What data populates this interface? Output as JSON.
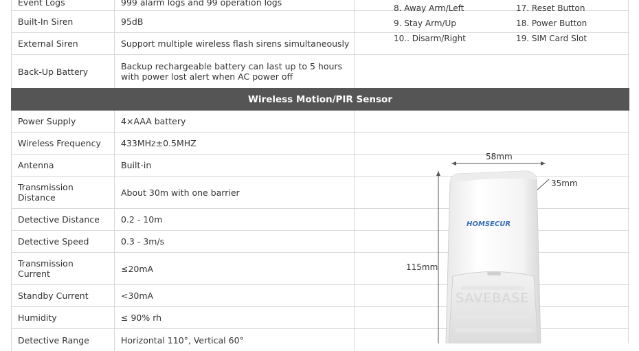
{
  "top_rows": [
    {
      "label": "Event Logs",
      "value": "999 alarm logs and 99 operation logs"
    },
    {
      "label": "Built-In Siren",
      "value": "95dB"
    },
    {
      "label": "External Siren",
      "value": "Support multiple wireless flash sirens simultaneously"
    },
    {
      "label": "Back-Up Battery",
      "value": "Backup rechargeable battery can last up to 5 hours with power lost alert when AC power off"
    }
  ],
  "button_list": {
    "left": [
      "8. Away Arm/Left",
      "9. Stay Arm/Up",
      "10.. Disarm/Right"
    ],
    "right": [
      "17. Reset Button",
      "18. Power Button",
      "19. SIM Card Slot"
    ]
  },
  "section_title": "Wireless Motion/PIR Sensor",
  "sensor_rows": [
    {
      "label": "Power Supply",
      "value": "4×AAA battery"
    },
    {
      "label": "Wireless Frequency",
      "value": "433MHz±0.5MHZ"
    },
    {
      "label": "Antenna",
      "value": "Built-in"
    },
    {
      "label": "Transmission Distance",
      "value": "About 30m with one barrier"
    },
    {
      "label": "Detective Distance",
      "value": "0.2 - 10m"
    },
    {
      "label": "Detective Speed",
      "value": "0.3 - 3m/s"
    },
    {
      "label": "Transmission Current",
      "value": "≤20mA"
    },
    {
      "label": "Standby Current",
      "value": "<30mA"
    },
    {
      "label": "Humidity",
      "value": "≤ 90% rh"
    },
    {
      "label": "Detective Range",
      "value": "Horizontal 110°, Vertical 60°"
    }
  ],
  "dimensions": {
    "width": "58mm",
    "depth": "35mm",
    "height": "115mm"
  },
  "brand_logo": "HOMSECUR",
  "watermark": "SAVEBASE"
}
